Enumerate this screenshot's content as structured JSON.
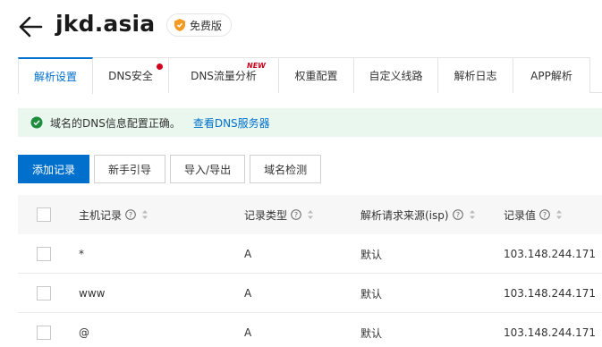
{
  "header": {
    "domain": "jkd.asia",
    "plan_badge": "免费版",
    "icons": {
      "back": "back-arrow-icon",
      "badge": "shield-badge-icon"
    },
    "badge_color": "#f59a23"
  },
  "tabs": [
    {
      "label": "解析设置",
      "active": true
    },
    {
      "label": "DNS安全",
      "dot": true
    },
    {
      "label": "DNS流量分析",
      "badge": "NEW"
    },
    {
      "label": "权重配置"
    },
    {
      "label": "自定义线路"
    },
    {
      "label": "解析日志"
    },
    {
      "label": "APP解析"
    }
  ],
  "alert": {
    "message": "域名的DNS信息配置正确。",
    "link": "查看DNS服务器",
    "icon": "check-circle-icon",
    "color": "#1e8e3e"
  },
  "toolbar": {
    "add_record": "添加记录",
    "guide": "新手引导",
    "import_export": "导入/导出",
    "domain_check": "域名检测"
  },
  "table": {
    "columns": [
      "主机记录",
      "记录类型",
      "解析请求来源(isp)",
      "记录值"
    ],
    "rows": [
      {
        "host": "*",
        "type": "A",
        "isp": "默认",
        "value": "103.148.244.171"
      },
      {
        "host": "www",
        "type": "A",
        "isp": "默认",
        "value": "103.148.244.171"
      },
      {
        "host": "@",
        "type": "A",
        "isp": "默认",
        "value": "103.148.244.171"
      }
    ]
  },
  "colors": {
    "accent": "#0070cc",
    "alert_bg": "#e9f7ee",
    "new_badge": "#d0021b"
  }
}
